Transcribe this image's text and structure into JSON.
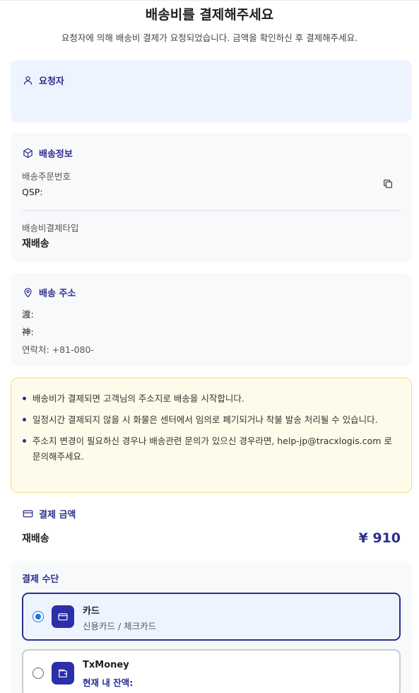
{
  "page": {
    "title": "배송비를 결제해주세요",
    "subtitle": "요청자에 의해 배송비 결제가 요청되었습니다. 금액을 확인하신 후 결제해주세요."
  },
  "requester": {
    "heading": "요청자",
    "icon": "user-icon"
  },
  "shipping_info": {
    "heading": "배송정보",
    "icon": "package-icon",
    "order_no_label": "배송주문번호",
    "order_no_value": "QSP:",
    "payment_type_label": "배송비결제타입",
    "payment_type_value": "재배송"
  },
  "address": {
    "heading": "배송 주소",
    "icon": "map-pin-icon",
    "line1": "渡:",
    "line2": "神:",
    "contact": "연락처: +81-080-"
  },
  "notice": {
    "items": [
      "배송비가 결제되면 고객님의 주소지로 배송을 시작합니다.",
      "일정시간 결제되지 않을 시 화물은 센터에서 임의로 폐기되거나 착불 발송 처리될 수 있습니다.",
      "주소지 변경이 필요하신 경우나 배송관련 문의가 있으신 경우라면, help-jp@tracxlogis.com 로 문의해주세요."
    ]
  },
  "payment_amount": {
    "heading": "결제 금액",
    "icon": "credit-card-icon",
    "type": "재배송",
    "amount": "¥ 910"
  },
  "payment_method": {
    "heading": "결제 수단",
    "options": [
      {
        "name": "카드",
        "desc": "신용카드 / 체크카드",
        "selected": true,
        "icon": "card-icon"
      },
      {
        "name": "TxMoney",
        "desc": "현재 내 잔액:",
        "selected": false,
        "icon": "wallet-icon"
      }
    ]
  },
  "colors": {
    "accent": "#2b2f8f",
    "radio_selected": "#1a73e8",
    "requester_bg": "#eef4ff",
    "notice_bg": "#fffbea",
    "notice_border": "#f4dc8a"
  }
}
